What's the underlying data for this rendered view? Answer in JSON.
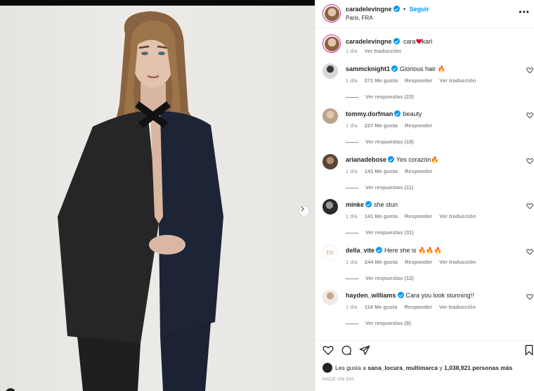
{
  "header": {
    "username": "caradelevingne",
    "follow_label": "Seguir",
    "location": "Paris, FRA",
    "more_label": "•••"
  },
  "caption": {
    "username": "caradelevingne",
    "text_before": "cara",
    "text_after": "karl",
    "time": "1 día",
    "translate": "Ver traducción"
  },
  "comments": [
    {
      "username": "sammcknight1",
      "text": "Glorious hair 🔥",
      "time": "1 día",
      "likes": "271 Me gusta",
      "reply": "Responder",
      "translate": "Ver traducción",
      "replies": "Ver respuestas (23)",
      "avatar_color": "#d8d8d8"
    },
    {
      "username": "tommy.dorfman",
      "text": "beauty",
      "time": "1 día",
      "likes": "227 Me gusta",
      "reply": "Responder",
      "translate": "",
      "replies": "Ver respuestas (18)",
      "avatar_color": "#b9a48c"
    },
    {
      "username": "arianadebose",
      "text": "Yes corazón🔥",
      "time": "1 día",
      "likes": "141 Me gusta",
      "reply": "Responder",
      "translate": "",
      "replies": "Ver respuestas (11)",
      "avatar_color": "#8a6a55"
    },
    {
      "username": "minke",
      "text": "she stun",
      "time": "1 día",
      "likes": "141 Me gusta",
      "reply": "Responder",
      "translate": "Ver traducción",
      "replies": "Ver respuestas (31)",
      "avatar_color": "#2a2a2a"
    },
    {
      "username": "della_vite",
      "text": "Here she is 🔥🔥🔥",
      "time": "1 día",
      "likes": "244 Me gusta",
      "reply": "Responder",
      "translate": "Ver traducción",
      "replies": "Ver respuestas (12)",
      "avatar_color": "#ffffff",
      "avatar_text": "DV"
    },
    {
      "username": "hayden_williams",
      "text": "Cara you look stunning!!",
      "time": "1 día",
      "likes": "116 Me gusta",
      "reply": "Responder",
      "translate": "Ver traducción",
      "replies": "Ver respuestas (9)",
      "avatar_color": "#d0ccc8"
    }
  ],
  "likes": {
    "prefix": "Les gusta a",
    "user": "sana_locura_multimarca",
    "middle": "y",
    "count": "1,038,921 personas más"
  },
  "timestamp": "HACE UN DÍA",
  "colors": {
    "accent": "#0095f6",
    "ring": "#d6249f",
    "heart_red": "#e0001b"
  }
}
